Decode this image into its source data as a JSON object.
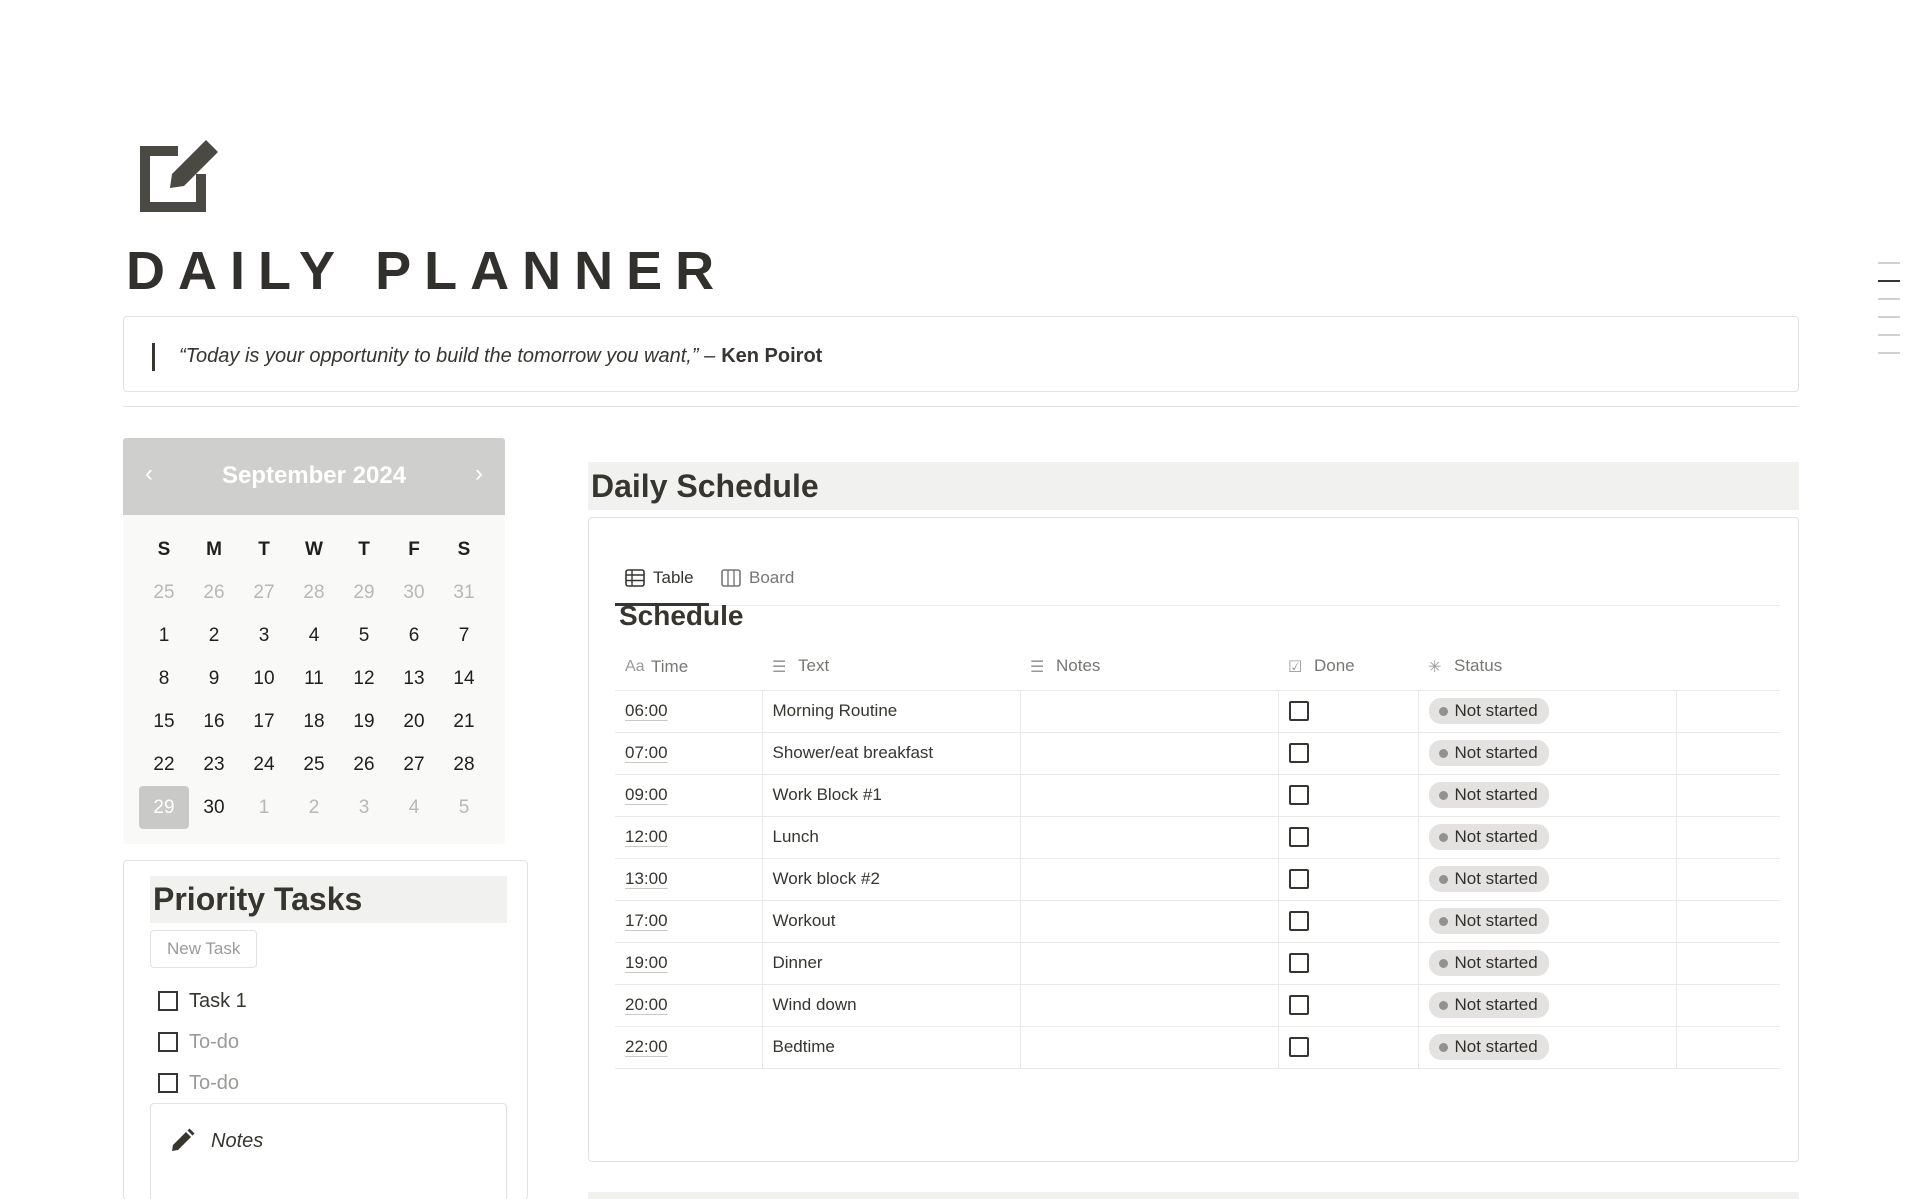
{
  "page": {
    "title": "DAILY PLANNER",
    "icon": "note-edit-icon"
  },
  "quote": {
    "text": "“Today is your opportunity to build the tomorrow you want,” –",
    "author": "Ken Poirot"
  },
  "calendar": {
    "month_label": "September 2024",
    "prev_icon": "chevron-left-icon",
    "next_icon": "chevron-right-icon",
    "weekdays": [
      "S",
      "M",
      "T",
      "W",
      "T",
      "F",
      "S"
    ],
    "weeks": [
      [
        "25",
        "26",
        "27",
        "28",
        "29",
        "30",
        "31"
      ],
      [
        "1",
        "2",
        "3",
        "4",
        "5",
        "6",
        "7"
      ],
      [
        "8",
        "9",
        "10",
        "11",
        "12",
        "13",
        "14"
      ],
      [
        "15",
        "16",
        "17",
        "18",
        "19",
        "20",
        "21"
      ],
      [
        "22",
        "23",
        "24",
        "25",
        "26",
        "27",
        "28"
      ],
      [
        "29",
        "30",
        "1",
        "2",
        "3",
        "4",
        "5"
      ]
    ],
    "selected_day": "29",
    "colors": {
      "header": "#cfcfcd",
      "today": "#c9c9c7"
    }
  },
  "priority_tasks": {
    "title": "Priority Tasks",
    "new_task_label": "New Task",
    "items": [
      {
        "label": "Task 1",
        "placeholder": false
      },
      {
        "label": "To-do",
        "placeholder": true
      },
      {
        "label": "To-do",
        "placeholder": true
      }
    ],
    "notes_label": "Notes",
    "notes_icon": "pencil-icon"
  },
  "schedule": {
    "heading": "Daily Schedule",
    "tabs": [
      {
        "label": "Table",
        "icon": "table-icon",
        "active": true
      },
      {
        "label": "Board",
        "icon": "board-icon",
        "active": false
      }
    ],
    "db_title": "Schedule",
    "columns": [
      {
        "label": "Time",
        "icon": "Aa"
      },
      {
        "label": "Text",
        "icon": "text-lines-icon"
      },
      {
        "label": "Notes",
        "icon": "text-lines-icon"
      },
      {
        "label": "Done",
        "icon": "checkbox-icon"
      },
      {
        "label": "Status",
        "icon": "status-spinner-icon"
      }
    ],
    "rows": [
      {
        "time": "06:00",
        "text": "Morning Routine",
        "notes": "",
        "done": false,
        "status": "Not started"
      },
      {
        "time": "07:00",
        "text": "Shower/eat breakfast",
        "notes": "",
        "done": false,
        "status": "Not started"
      },
      {
        "time": "09:00",
        "text": "Work Block #1",
        "notes": "",
        "done": false,
        "status": "Not started"
      },
      {
        "time": "12:00",
        "text": "Lunch",
        "notes": "",
        "done": false,
        "status": "Not started"
      },
      {
        "time": "13:00",
        "text": "Work block #2",
        "notes": "",
        "done": false,
        "status": "Not started"
      },
      {
        "time": "17:00",
        "text": "Workout",
        "notes": "",
        "done": false,
        "status": "Not started"
      },
      {
        "time": "19:00",
        "text": "Dinner",
        "notes": "",
        "done": false,
        "status": "Not started"
      },
      {
        "time": "20:00",
        "text": "Wind down",
        "notes": "",
        "done": false,
        "status": "Not started"
      },
      {
        "time": "22:00",
        "text": "Bedtime",
        "notes": "",
        "done": false,
        "status": "Not started"
      }
    ],
    "colors": {
      "status_pill": "#e3e2e0",
      "status_dot": "#91918e"
    }
  }
}
